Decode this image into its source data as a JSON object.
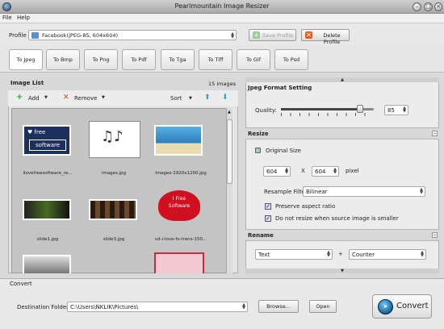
{
  "window": {
    "title": "Pearlmountain Image Resizer"
  },
  "menu": [
    "File",
    "Help"
  ],
  "profile": {
    "label": "Profile",
    "value": "Facebook(JPEG-85, 604x604)",
    "save_label": "Save Profile",
    "delete_label": "Delete Profile"
  },
  "tabs": [
    "To Jpeg",
    "To Bmp",
    "To Png",
    "To Pdf",
    "To Tga",
    "To Tiff",
    "To Gif",
    "To Psd"
  ],
  "image_list": {
    "title": "Image List",
    "count": "15 images",
    "add_label": "Add",
    "remove_label": "Remove",
    "sort_label": "Sort",
    "items": [
      {
        "caption": "ilovefreesoftware_re...",
        "kind": "ilovefree-logo"
      },
      {
        "caption": "images.jpg",
        "kind": "music-notes"
      },
      {
        "caption": "Images-1920x1200.jpg",
        "kind": "beach"
      },
      {
        "caption": "slide1.jpg",
        "kind": "green-dark"
      },
      {
        "caption": "slide3.jpg",
        "kind": "film-strip"
      },
      {
        "caption": "vd-i-love-fs-trans-150...",
        "kind": "heart-free-software"
      },
      {
        "caption": "",
        "kind": "gray-photo"
      },
      {
        "caption": "",
        "kind": "blank"
      },
      {
        "caption": "",
        "kind": "pink-love"
      }
    ]
  },
  "jpeg_format": {
    "title": "Jpeg Format Setting",
    "quality_label": "Quality:",
    "quality_value": "85",
    "quality_fraction": 0.85
  },
  "resize": {
    "title": "Resize",
    "original_size_label": "Original Size",
    "width": "604",
    "x_label": "X",
    "height": "604",
    "unit": "pixel",
    "filter_label": "Resample Filter:",
    "filter_value": "Bilinear",
    "preserve_label": "Preserve aspect ratio",
    "no_resize_label": "Do not resize when source image is smaller"
  },
  "rename": {
    "title": "Rename",
    "field1": "Text",
    "plus": "+",
    "field2": "Counter"
  },
  "convert": {
    "section_title": "Convert",
    "dest_label": "Destination Folder:",
    "dest_value": "C:\\Users\\NKLIK\\Pictures\\",
    "browse_label": "Browse...",
    "open_label": "Open",
    "convert_label": "Convert"
  }
}
